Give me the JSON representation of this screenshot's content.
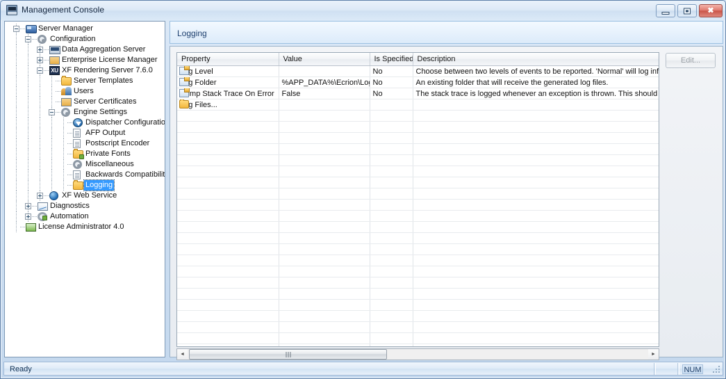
{
  "window": {
    "title": "Management Console",
    "icon": "app-icon",
    "controls": {
      "minimize": "minimize",
      "maximize": "maximize",
      "close": "close"
    }
  },
  "tree": {
    "items": [
      {
        "label": "Server Manager",
        "depth": 0,
        "icon": "truck-icon",
        "expander": "minus",
        "selected": false
      },
      {
        "label": "Configuration",
        "depth": 1,
        "icon": "gear-icon",
        "expander": "minus",
        "selected": false
      },
      {
        "label": "Data Aggregation Server",
        "depth": 2,
        "icon": "das-icon",
        "expander": "plus",
        "selected": false
      },
      {
        "label": "Enterprise License Manager",
        "depth": 2,
        "icon": "screen-icon",
        "expander": "plus",
        "selected": false
      },
      {
        "label": "XF Rendering Server 7.6.0",
        "depth": 2,
        "icon": "xu-icon",
        "expander": "minus",
        "selected": false
      },
      {
        "label": "Server Templates",
        "depth": 3,
        "icon": "folder-icon",
        "expander": "none",
        "selected": false
      },
      {
        "label": "Users",
        "depth": 3,
        "icon": "users-icon",
        "expander": "none",
        "selected": false
      },
      {
        "label": "Server Certificates",
        "depth": 3,
        "icon": "screen-icon",
        "expander": "none",
        "selected": false
      },
      {
        "label": "Engine Settings",
        "depth": 3,
        "icon": "gear-icon",
        "expander": "minus",
        "selected": false
      },
      {
        "label": "Dispatcher Configuration",
        "depth": 4,
        "icon": "dispatcher-icon",
        "expander": "none",
        "selected": false
      },
      {
        "label": "AFP Output",
        "depth": 4,
        "icon": "document-icon",
        "expander": "none",
        "selected": false
      },
      {
        "label": "Postscript Encoder",
        "depth": 4,
        "icon": "document-icon",
        "expander": "none",
        "selected": false
      },
      {
        "label": "Private Fonts",
        "depth": 4,
        "icon": "folder-lock-icon",
        "expander": "none",
        "selected": false
      },
      {
        "label": "Miscellaneous",
        "depth": 4,
        "icon": "gear-icon",
        "expander": "none",
        "selected": false
      },
      {
        "label": "Backwards Compatibility",
        "depth": 4,
        "icon": "document-icon",
        "expander": "none",
        "selected": false
      },
      {
        "label": "Logging",
        "depth": 4,
        "icon": "folder-icon",
        "expander": "none",
        "selected": true
      },
      {
        "label": "XF Web Service",
        "depth": 2,
        "icon": "globe-icon",
        "expander": "plus",
        "selected": false
      },
      {
        "label": "Diagnostics",
        "depth": 1,
        "icon": "chart-icon",
        "expander": "plus",
        "selected": false
      },
      {
        "label": "Automation",
        "depth": 1,
        "icon": "automation-icon",
        "expander": "plus",
        "selected": false
      },
      {
        "label": "License Administrator 4.0",
        "depth": 0,
        "icon": "license-icon",
        "expander": "none",
        "selected": false
      }
    ]
  },
  "tab": {
    "label": "Logging"
  },
  "panel": {
    "edit_button": "Edit...",
    "grid": {
      "columns": [
        "Property",
        "Value",
        "Is Specified",
        "Description"
      ],
      "rows": [
        {
          "icon": "property-icon",
          "property": "Log Level",
          "value": "",
          "is_specified": "No",
          "description": "Choose between two levels of events to be reported. 'Normal' will log infor"
        },
        {
          "icon": "property-icon",
          "property": "Log Folder",
          "value": "%APP_DATA%\\Ecrion\\Log\\",
          "is_specified": "No",
          "description": "An existing folder that will receive the generated log files."
        },
        {
          "icon": "property-icon",
          "property": "Dump Stack Trace On Error",
          "value": "False",
          "is_specified": "No",
          "description": "The stack trace is logged whenever an exception is thrown. This should be"
        },
        {
          "icon": "folder-icon",
          "property": "Log Files...",
          "value": "",
          "is_specified": "",
          "description": ""
        }
      ],
      "empty_row_count": 24
    },
    "scrollbar": {
      "left_arrow": "◄",
      "right_arrow": "►"
    }
  },
  "statusbar": {
    "message": "Ready",
    "num_indicator": "NUM"
  }
}
